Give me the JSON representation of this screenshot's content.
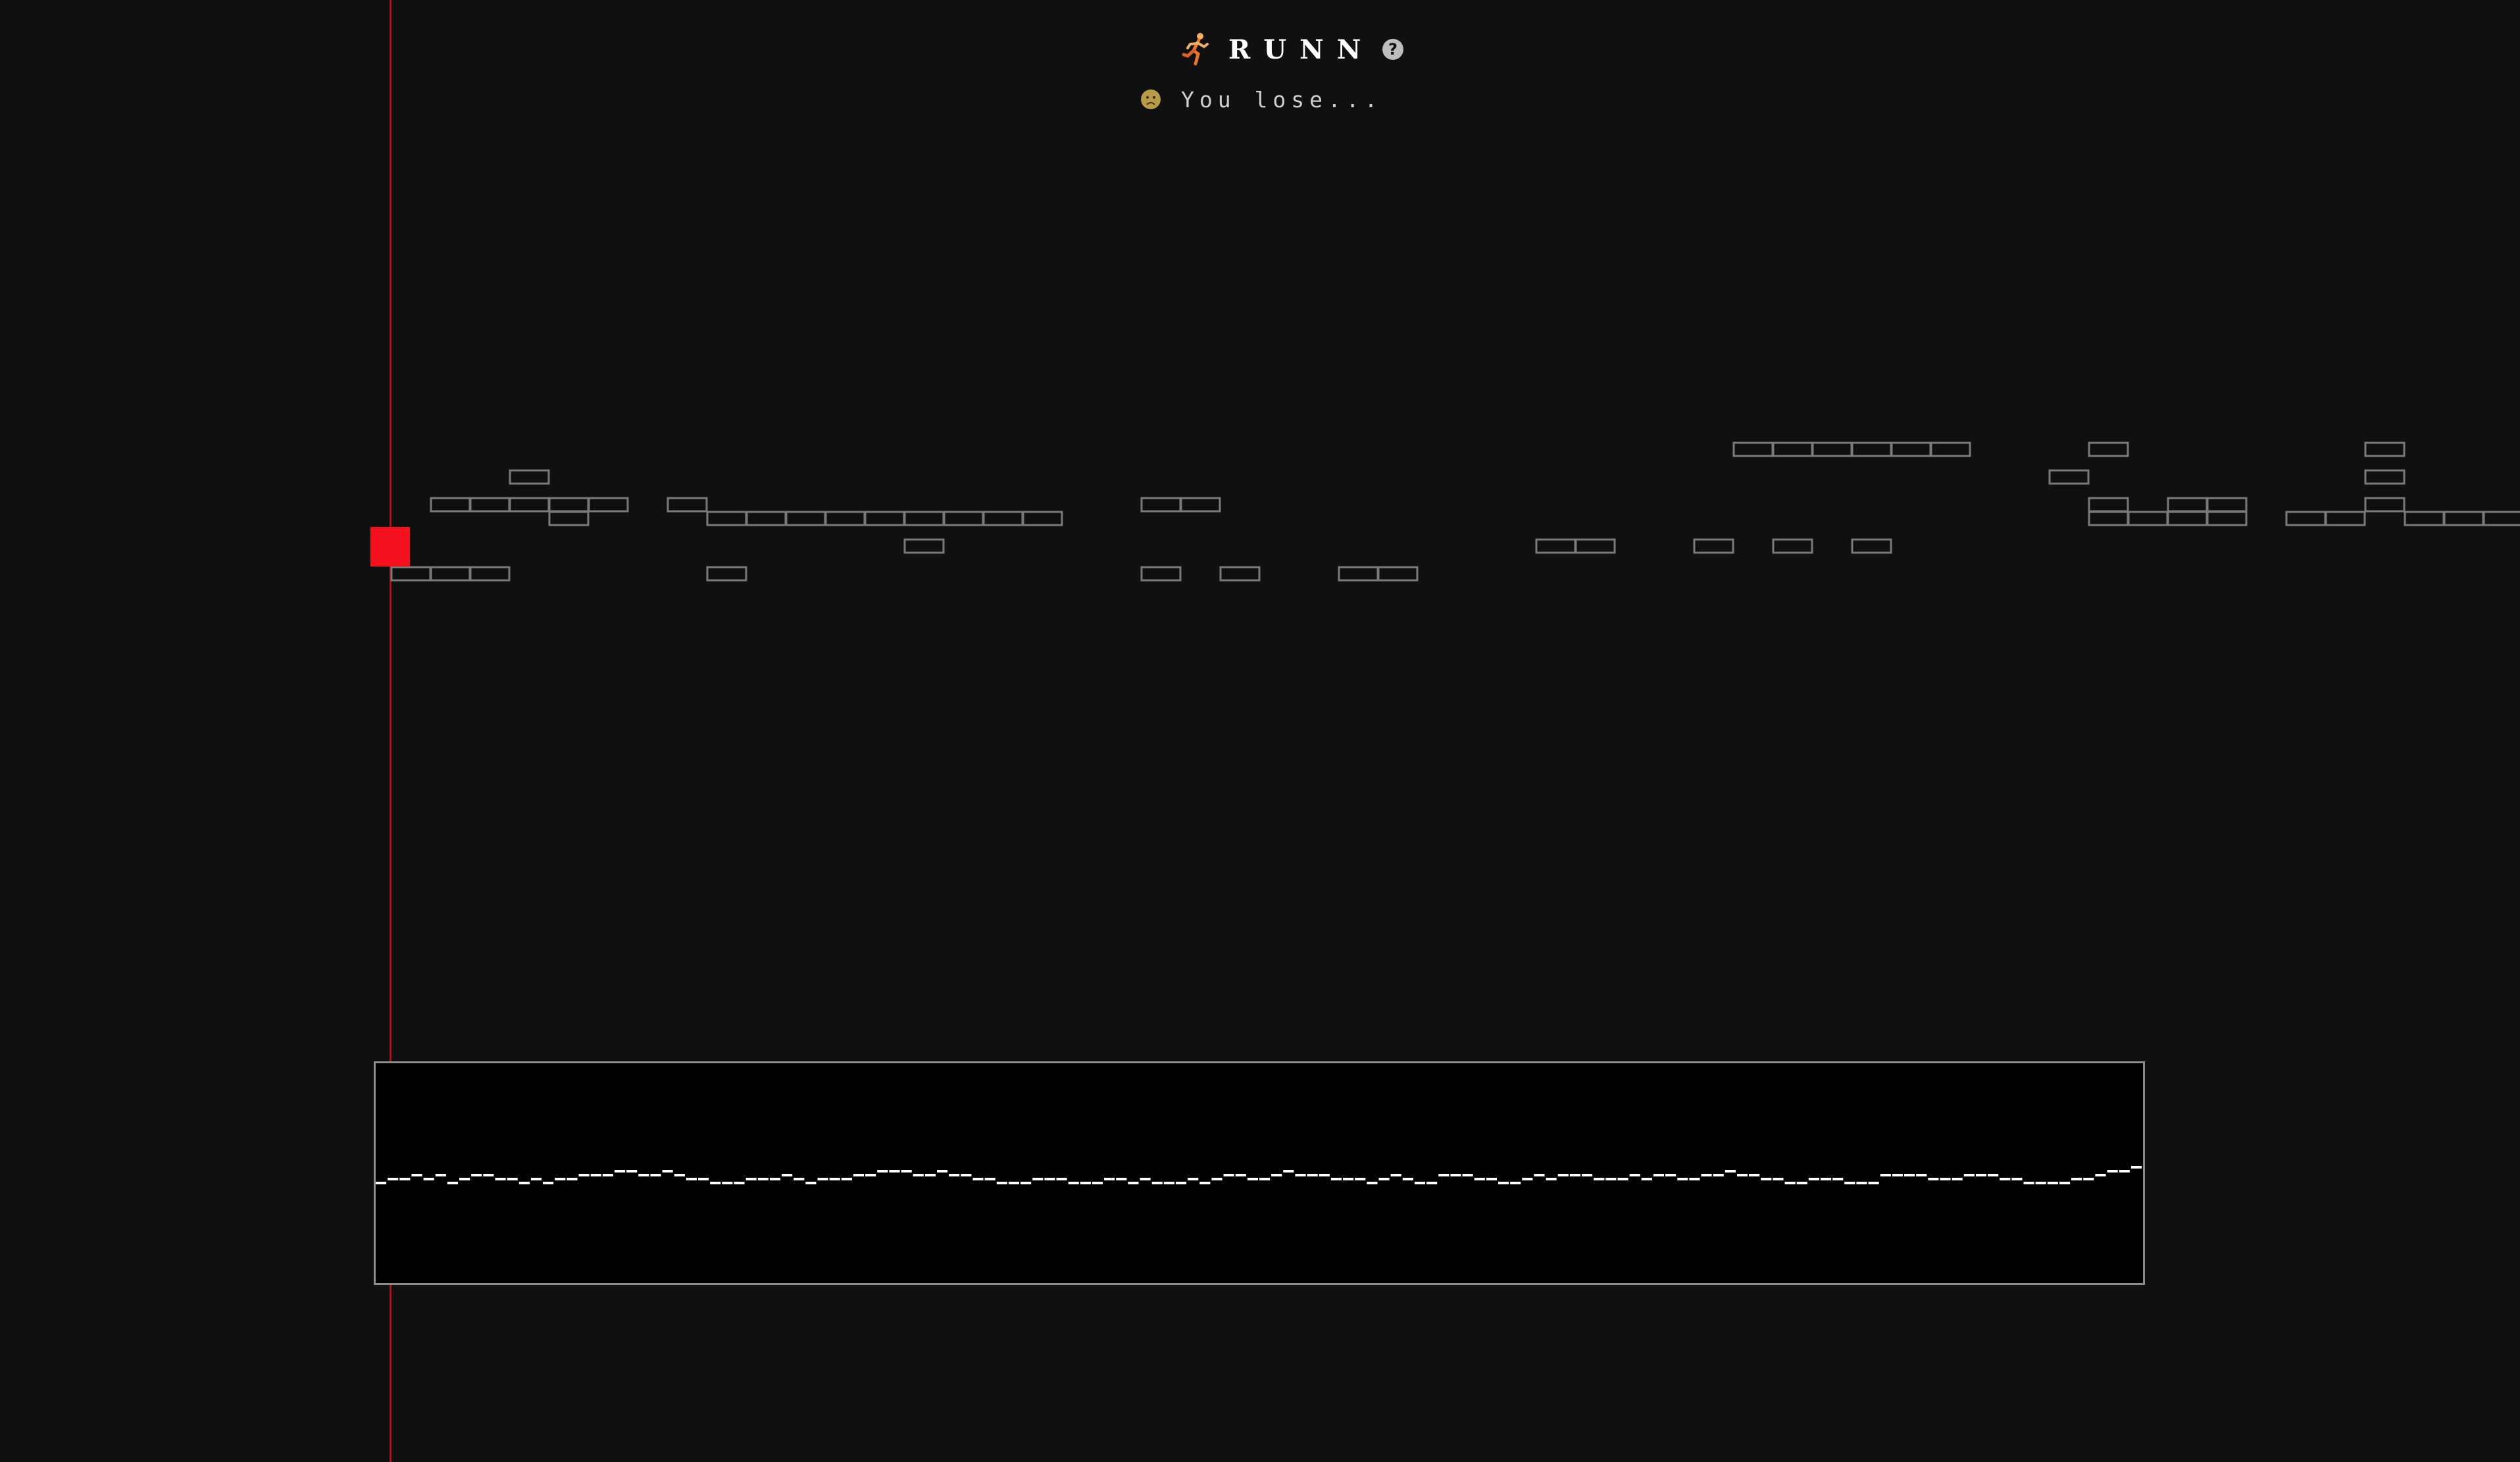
{
  "header": {
    "runner_icon": "runner-icon",
    "title": "RUNN",
    "help_label": "?",
    "status_icon": "frowning-face-icon",
    "status_text": "You lose..."
  },
  "game": {
    "state": "lost",
    "player_color": "#f2111d",
    "playhead_color": "#a5121a",
    "platform_color": "#7a7a7a",
    "platform_rows": [
      "..................................######...#......#.......................",
      "...#......................................#.......#...###..#...#..........",
      ".#####.#...........##......................#.##...#...####....#...........",
      "....#...#########..........................####.##.####.....##..####....##",
      ".............#...............##..#.#.#..............................#.....",
      "###.....#..........#.#..##...............................######.#......###"
    ]
  },
  "waveform": {
    "background": "#000000",
    "border_color": "#8c8c8c",
    "line_color": "#ffffff",
    "levels": [
      0,
      1,
      1,
      2,
      1,
      2,
      0,
      1,
      2,
      2,
      1,
      1,
      0,
      1,
      0,
      1,
      1,
      2,
      2,
      2,
      3,
      3,
      2,
      2,
      3,
      2,
      1,
      1,
      0,
      0,
      0,
      1,
      1,
      1,
      2,
      1,
      0,
      1,
      1,
      1,
      2,
      2,
      3,
      3,
      3,
      2,
      2,
      3,
      2,
      2,
      1,
      1,
      0,
      0,
      0,
      1,
      1,
      1,
      0,
      0,
      0,
      1,
      1,
      0,
      1,
      0,
      0,
      0,
      1,
      0,
      1,
      2,
      2,
      1,
      1,
      2,
      3,
      2,
      2,
      2,
      1,
      1,
      1,
      0,
      1,
      2,
      1,
      0,
      0,
      2,
      2,
      2,
      1,
      1,
      0,
      0,
      1,
      2,
      1,
      2,
      2,
      2,
      1,
      1,
      1,
      2,
      1,
      2,
      2,
      1,
      1,
      2,
      2,
      3,
      2,
      2,
      1,
      1,
      0,
      0,
      1,
      1,
      1,
      0,
      0,
      0,
      2,
      2,
      2,
      2,
      1,
      1,
      1,
      2,
      2,
      2,
      1,
      1,
      0,
      0,
      0,
      0,
      1,
      1,
      2,
      3,
      3,
      4
    ]
  }
}
